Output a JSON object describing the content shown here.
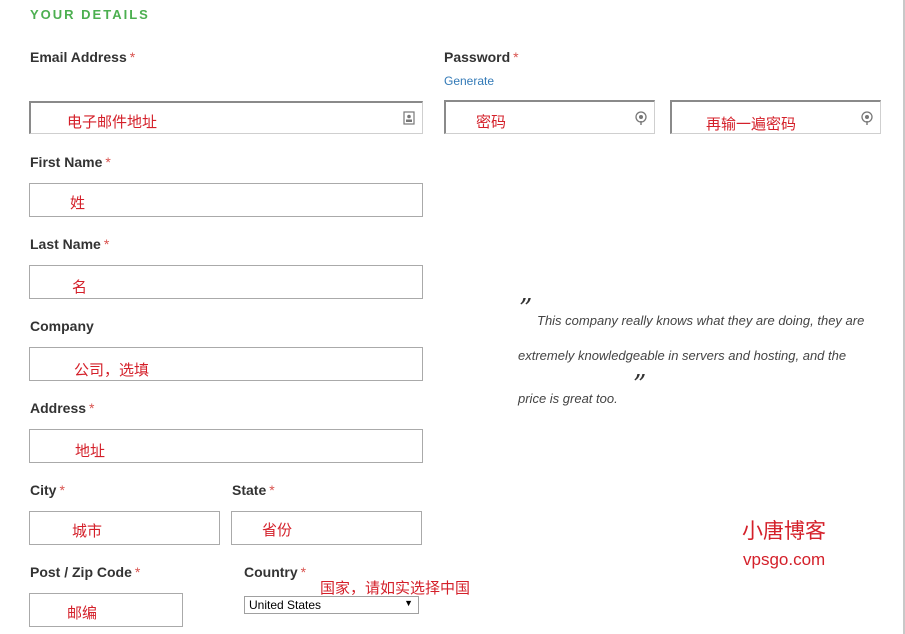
{
  "section": {
    "title": "YOUR DETAILS"
  },
  "required_marker": "*",
  "fields": {
    "email": {
      "label": "Email Address",
      "required": true,
      "annotation": "电子邮件地址",
      "icon": "contact-card-icon"
    },
    "password": {
      "label": "Password",
      "required": true,
      "generate_link": "Generate",
      "annotation": "密码",
      "icon": "key-icon"
    },
    "password_confirm": {
      "annotation": "再输一遍密码",
      "icon": "key-icon"
    },
    "first_name": {
      "label": "First Name",
      "required": true,
      "annotation": "姓"
    },
    "last_name": {
      "label": "Last Name",
      "required": true,
      "annotation": "名"
    },
    "company": {
      "label": "Company",
      "required": false,
      "annotation": "公司，选填"
    },
    "address": {
      "label": "Address",
      "required": true,
      "annotation": "地址"
    },
    "city": {
      "label": "City",
      "required": true,
      "annotation": "城市"
    },
    "state": {
      "label": "State",
      "required": true,
      "annotation": "省份"
    },
    "postcode": {
      "label": "Post / Zip Code",
      "required": true,
      "annotation": "邮编"
    },
    "country": {
      "label": "Country",
      "required": true,
      "selected": "United States",
      "annotation": "国家，请如实选择中国"
    }
  },
  "testimonial": {
    "open_quote": "”",
    "close_quote": "”",
    "lines": [
      "This company really knows what they are doing, they are",
      "extremely knowledgeable in servers and hosting, and the",
      "price is great too."
    ]
  },
  "watermark": {
    "name": "小唐博客",
    "url": "vpsgo.com"
  },
  "colors": {
    "section_title": "#4caf50",
    "required": "#d9534f",
    "link": "#337ab7",
    "annotation": "#d4202a"
  }
}
